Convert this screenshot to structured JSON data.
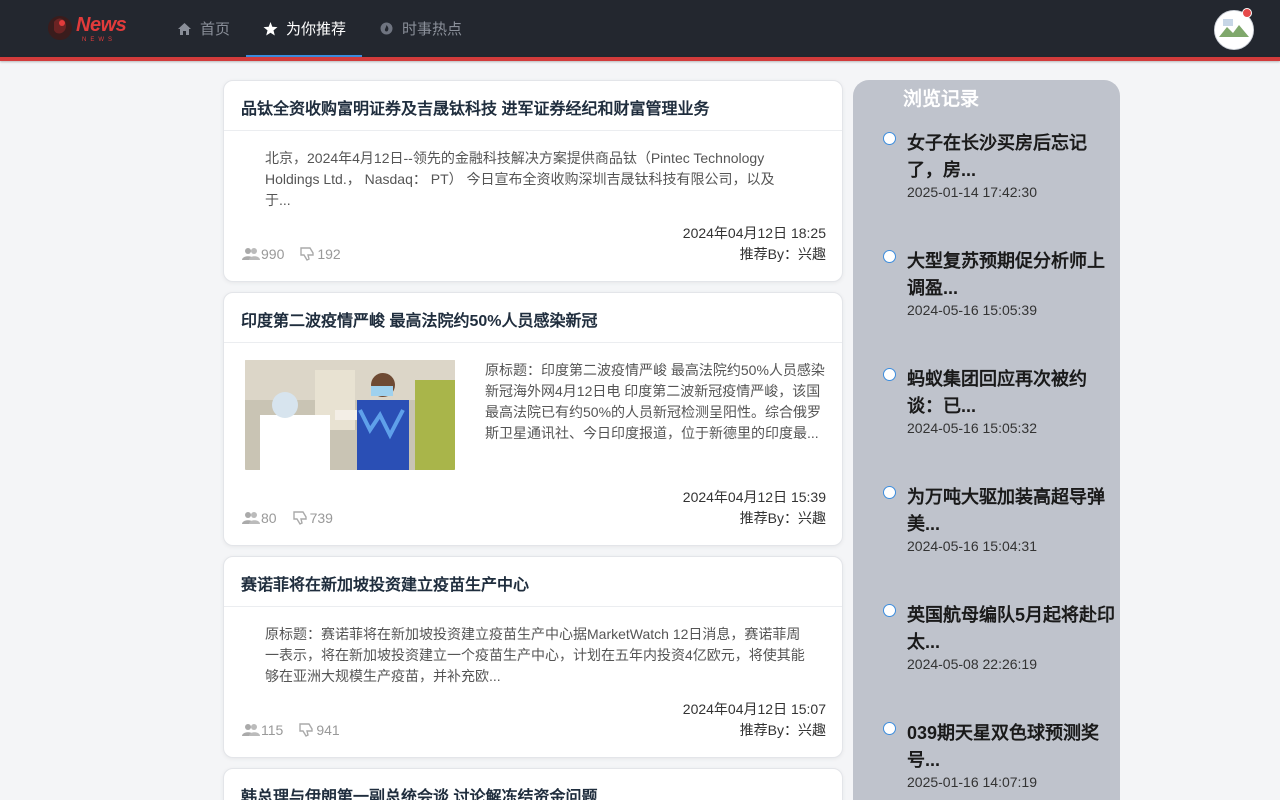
{
  "header": {
    "logo_text": "News",
    "logo_sub": "NEWS",
    "nav": [
      {
        "label": "首页",
        "icon": "home-icon",
        "active": false
      },
      {
        "label": "为你推荐",
        "icon": "star-icon",
        "active": true
      },
      {
        "label": "时事热点",
        "icon": "fire-icon",
        "active": false
      }
    ]
  },
  "feed": {
    "articles": [
      {
        "title": "品钛全资收购富明证券及吉晟钛科技 进军证券经纪和财富管理业务",
        "summary": "北京，2024年4月12日--领先的金融科技解决方案提供商品钛（Pintec Technology Holdings Ltd.， Nasdaq： PT） 今日宣布全资收购深圳吉晟钛科技有限公司，以及于...",
        "views": "990",
        "dislikes": "192",
        "date": "2024年04月12日 18:25",
        "recommend": "推荐By：兴趣",
        "has_image": false
      },
      {
        "title": "印度第二波疫情严峻 最高法院约50%人员感染新冠",
        "summary": "原标题：印度第二波疫情严峻 最高法院约50%人员感染新冠海外网4月12日电 印度第二波新冠疫情严峻，该国最高法院已有约50%的人员新冠检测呈阳性。综合俄罗斯卫星通讯社、今日印度报道，位于新德里的印度最...",
        "views": "80",
        "dislikes": "739",
        "date": "2024年04月12日 15:39",
        "recommend": "推荐By：兴趣",
        "has_image": true
      },
      {
        "title": "赛诺菲将在新加坡投资建立疫苗生产中心",
        "summary": "原标题：赛诺菲将在新加坡投资建立疫苗生产中心据MarketWatch 12日消息，赛诺菲周一表示，将在新加坡投资建立一个疫苗生产中心，计划在五年内投资4亿欧元，将使其能够在亚洲大规模生产疫苗，并补充欧...",
        "views": "115",
        "dislikes": "941",
        "date": "2024年04月12日 15:07",
        "recommend": "推荐By：兴趣",
        "has_image": false
      },
      {
        "title": "韩总理与伊朗第一副总统会谈 讨论解冻结资金问题"
      }
    ]
  },
  "sidebar": {
    "title": "浏览记录",
    "items": [
      {
        "title": "女子在长沙买房后忘记了，房...",
        "time": "2025-01-14 17:42:30"
      },
      {
        "title": "大型复苏预期促分析师上调盈...",
        "time": "2024-05-16 15:05:39"
      },
      {
        "title": "蚂蚁集团回应再次被约谈：已...",
        "time": "2024-05-16 15:05:32"
      },
      {
        "title": "为万吨大驱加装高超导弹美...",
        "time": "2024-05-16 15:04:31"
      },
      {
        "title": "英国航母编队5月起将赴印太...",
        "time": "2024-05-08 22:26:19"
      },
      {
        "title": "039期天星双色球预测奖号...",
        "time": "2025-01-16 14:07:19"
      }
    ]
  },
  "colors": {
    "header_bg": "#23272f",
    "accent_red": "#d23b3b",
    "active_underline": "#3c8dde",
    "sidebar_bg": "#bfc3cc"
  }
}
